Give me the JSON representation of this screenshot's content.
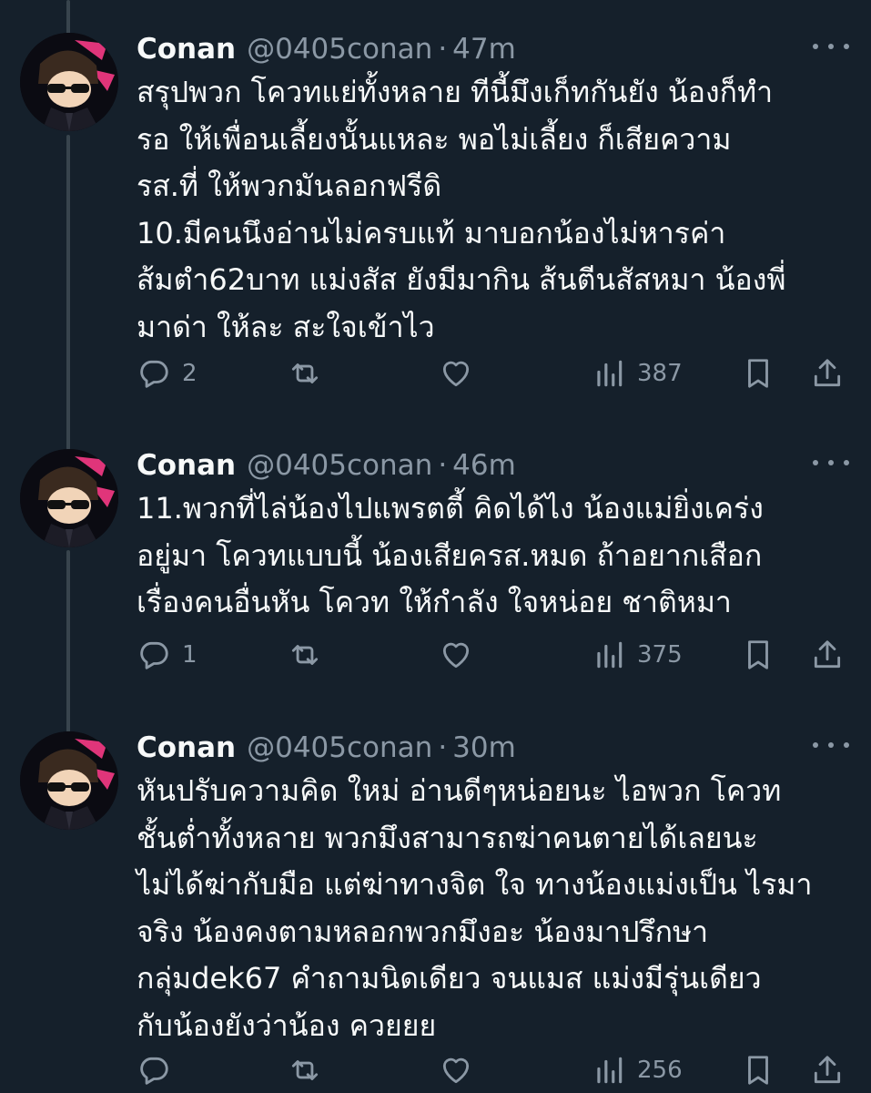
{
  "tweets": [
    {
      "name": "Conan",
      "handle": "@0405conan",
      "separator": "·",
      "time": "47m",
      "lines": [
        "สรุปพวก โควทแย่ทั้งหลาย ทีนี้มึงเก็ทกันยัง น้องก็ทำ",
        "รอ ให้เพื่อนเลี้ยงนั้นแหละ พอไม่เลี้ยง ก็เสียความ",
        "รส.ที่ ให้พวกมันลอกฟรีดิ",
        "10.มีคนนึงอ่านไม่ครบแท้ มาบอกน้องไม่หารค่า",
        "ส้มตำ62บาท แม่งสัส ยังมีมากิน ส้นตีนสัสหมา น้องพี่",
        "มาด่า ให้ละ สะใจเข้าไว"
      ],
      "replies": "2",
      "retweets": "",
      "likes": "",
      "views": "387"
    },
    {
      "name": "Conan",
      "handle": "@0405conan",
      "separator": "·",
      "time": "46m",
      "lines": [
        "11.พวกที่ไล่น้องไปแพรตตี้ คิดได้ไง น้องแม่ยิ่งเคร่ง",
        "อยู่มา โควทแบบนี้ น้องเสียครส.หมด ถ้าอยากเสือก",
        "เรื่องคนอื่นหัน โควท ให้กำลัง ใจหน่อย ชาติหมา"
      ],
      "replies": "1",
      "retweets": "",
      "likes": "",
      "views": "375"
    },
    {
      "name": "Conan",
      "handle": "@0405conan",
      "separator": "·",
      "time": "30m",
      "lines": [
        "หันปรับความคิด ใหม่ อ่านดีๆหน่อยนะ ไอพวก โควท",
        "ชั้นต่ำทั้งหลาย พวกมึงสามารถฆ่าคนตายได้เลยนะ",
        "ไม่ได้ฆ่ากับมือ แต่ฆ่าทางจิต ใจ ทางน้องแม่งเป็น ไรมา",
        "จริง น้องคงตามหลอกพวกมึงอะ น้องมาปรึกษา",
        "กลุ่มdek67 คำถามนิดเดียว จนแมส แม่งมีรุ่นเดียว",
        "กับน้องยังว่าน้อง ควยยย"
      ],
      "replies": "",
      "retweets": "",
      "likes": "",
      "views": "256"
    }
  ],
  "icons": {
    "reply": "reply-icon",
    "retweet": "retweet-icon",
    "like": "heart-icon",
    "views": "views-icon",
    "bookmark": "bookmark-icon",
    "share": "share-icon",
    "more": "more-icon"
  },
  "colors": {
    "background": "#15202b",
    "text": "#f7f9f9",
    "secondary": "#8b98a5",
    "thread_line": "#38444d",
    "avatar_accent": "#e0357a"
  }
}
